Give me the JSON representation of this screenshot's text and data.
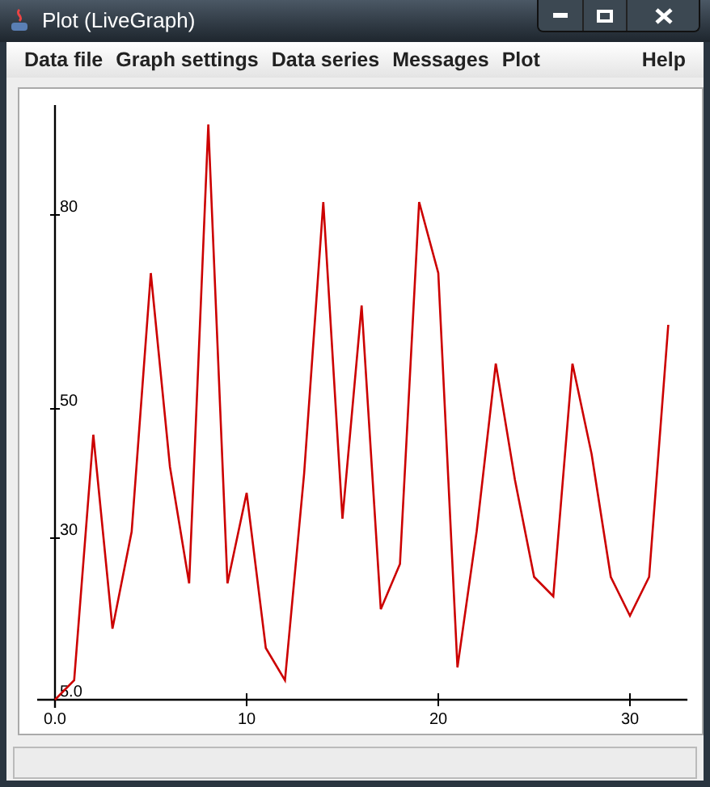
{
  "window": {
    "title": "Plot (LiveGraph)"
  },
  "menu": [
    {
      "label": "Data file"
    },
    {
      "label": "Graph settings"
    },
    {
      "label": "Data series"
    },
    {
      "label": "Messages"
    },
    {
      "label": "Plot"
    },
    {
      "label": "Help"
    }
  ],
  "plot": {
    "chart_data": {
      "type": "line",
      "x": [
        0,
        1,
        2,
        3,
        4,
        5,
        6,
        7,
        8,
        9,
        10,
        11,
        12,
        13,
        14,
        15,
        16,
        17,
        18,
        19,
        20,
        21,
        22,
        23,
        24,
        25,
        26,
        27,
        28,
        29,
        30,
        31,
        32
      ],
      "series": [
        {
          "color": "#cc0000",
          "values": [
            5,
            8,
            46,
            16,
            31,
            71,
            41,
            23,
            94,
            23,
            37,
            13,
            8,
            40,
            82,
            33,
            66,
            19,
            26,
            82,
            71,
            10,
            31,
            57,
            39,
            24,
            21,
            57,
            43,
            24,
            18,
            24,
            63
          ]
        }
      ],
      "xlim": [
        -0.93,
        33
      ],
      "ylim": [
        5,
        97
      ],
      "xticks": [
        {
          "value": 0,
          "label": "0.0"
        },
        10,
        20,
        30
      ],
      "yticks": [
        {
          "value": 5,
          "label": "5.0"
        },
        30,
        50,
        80
      ]
    }
  }
}
